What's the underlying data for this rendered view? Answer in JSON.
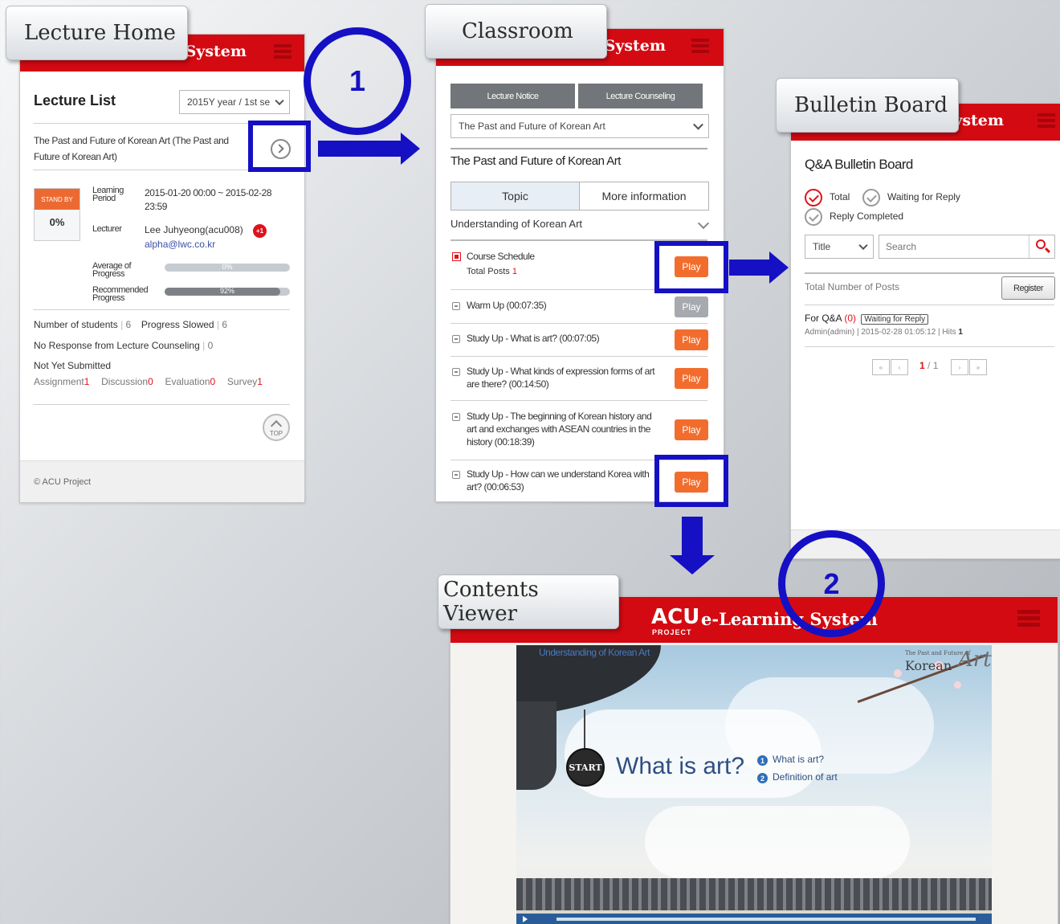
{
  "labels": {
    "lecture_home": "Lecture Home",
    "classroom": "Classroom",
    "bulletin_board": "Bulletin Board",
    "contents_viewer": "Contents Viewer"
  },
  "steps": {
    "one": "1",
    "two": "2"
  },
  "brand": {
    "short": "g System",
    "acu": "ACU",
    "elearning": "e-Learning System",
    "project": "PROJECT"
  },
  "lecture_home": {
    "title": "Lecture List",
    "semester": "2015Y year / 1st se",
    "course": "The Past and Future of Korean Art (The Past and Future of Korean Art)",
    "status_badge": "STAND BY",
    "status_percent": "0%",
    "learning_period_label": "Learning Period",
    "learning_period_value": "2015-01-20 00:00 ~ 2015-02-28 23:59",
    "lecturer_label": "Lecturer",
    "lecturer_name": "Lee Juhyeong(acu008)",
    "lecturer_badge": "+1",
    "lecturer_email": "alpha@lwc.co.kr",
    "avg_progress_label": "Average of Progress",
    "avg_progress_value": "0%",
    "rec_progress_label": "Recommended Progress",
    "rec_progress_value": "92%",
    "students_label": "Number of students",
    "students_value": "6",
    "slowed_label": "Progress Slowed",
    "slowed_value": "6",
    "no_response_label": "No Response from Lecture Counseling",
    "no_response_value": "0",
    "not_submitted_label": "Not Yet Submitted",
    "assignment_label": "Assignment",
    "assignment_value": "1",
    "discussion_label": "Discussion",
    "discussion_value": "0",
    "evaluation_label": "Evaluation",
    "evaluation_value": "0",
    "survey_label": "Survey",
    "survey_value": "1",
    "top_label": "TOP",
    "footer": "© ACU Project"
  },
  "classroom": {
    "notice_button": "Lecture Notice",
    "counseling_button": "Lecture Counseling",
    "course_select": "The Past and Future of Korean Art",
    "course_title": "The Past and Future of Korean Art",
    "tab_topic": "Topic",
    "tab_more": "More information",
    "section": "Understanding of Korean Art",
    "course_schedule": "Course Schedule",
    "total_posts_label": "Total Posts",
    "total_posts_value": "1",
    "items": [
      {
        "title": "Warm Up (00:07:35)"
      },
      {
        "title": "Study Up - What is art? (00:07:05)"
      },
      {
        "title": "Study Up - What kinds of expression forms of art are there? (00:14:50)"
      },
      {
        "title": "Study Up - The beginning of Korean history and art and exchanges with ASEAN countries in the history (00:18:39)"
      },
      {
        "title": "Study Up - How can we understand Korea with art? (00:06:53)"
      }
    ],
    "play_label": "Play"
  },
  "bulletin": {
    "title": "Q&A Bulletin Board",
    "filter_total": "Total",
    "filter_waiting": "Waiting for Reply",
    "filter_completed": "Reply Completed",
    "search_field": "Title",
    "search_placeholder": "Search",
    "total_posts_label": "Total Number of Posts",
    "register_button": "Register",
    "post_title": "For Q&A",
    "post_count": "(0)",
    "post_status": "Waiting for Reply",
    "post_meta": "Admin(admin)  |  2015-02-28 01:05:12  |  Hits",
    "post_hits": "1",
    "page_current": "1",
    "page_total": "/ 1"
  },
  "viewer": {
    "breadcrumb": "Understanding of Korean Art",
    "logo_small": "The Past and Future of",
    "logo_korean": "Korean",
    "logo_art": "Art",
    "start": "START",
    "headline": "What is art?",
    "toc_1_num": "1",
    "toc_1": "What is art?",
    "toc_2_num": "2",
    "toc_2": "Definition of art"
  },
  "colors": {
    "brand_red": "#d40a12",
    "annotation_blue": "#1510c4",
    "play_orange": "#f26d2d"
  }
}
